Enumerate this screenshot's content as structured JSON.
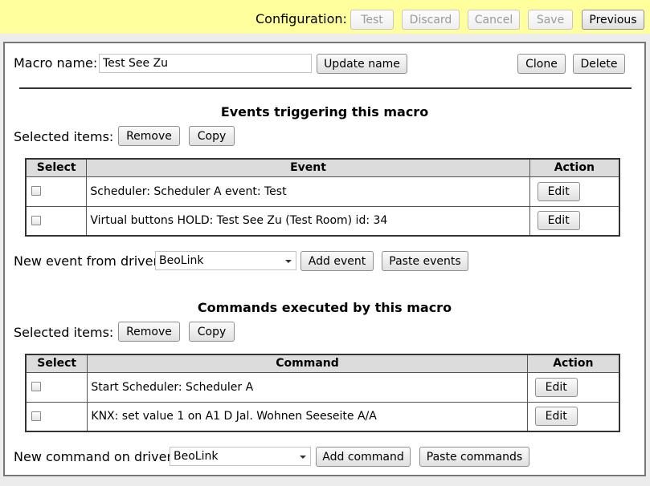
{
  "topbar": {
    "label": "Configuration:",
    "buttons": {
      "test": "Test",
      "discard": "Discard",
      "cancel": "Cancel",
      "save": "Save",
      "previous": "Previous"
    }
  },
  "macro": {
    "name_label": "Macro name:",
    "name_value": "Test See Zu",
    "update_label": "Update name",
    "clone_label": "Clone",
    "delete_label": "Delete"
  },
  "events": {
    "heading": "Events triggering this macro",
    "selected_label": "Selected items:",
    "remove_label": "Remove",
    "copy_label": "Copy",
    "columns": {
      "select": "Select",
      "event": "Event",
      "action": "Action"
    },
    "rows": [
      {
        "text": "Scheduler: Scheduler A event: Test",
        "action": "Edit"
      },
      {
        "text": "Virtual buttons HOLD: Test See Zu (Test Room) id: 34",
        "action": "Edit"
      }
    ],
    "new_label": "New event from driver:",
    "driver_value": "BeoLink",
    "add_label": "Add event",
    "paste_label": "Paste events"
  },
  "commands": {
    "heading": "Commands executed by this macro",
    "selected_label": "Selected items:",
    "remove_label": "Remove",
    "copy_label": "Copy",
    "columns": {
      "select": "Select",
      "command": "Command",
      "action": "Action"
    },
    "rows": [
      {
        "text": "Start Scheduler: Scheduler A",
        "action": "Edit"
      },
      {
        "text": "KNX: set value 1 on A1 D Jal. Wohnen Seeseite A/A",
        "action": "Edit"
      }
    ],
    "new_label": "New command on driver:",
    "driver_value": "BeoLink",
    "add_label": "Add command",
    "paste_label": "Paste commands"
  }
}
